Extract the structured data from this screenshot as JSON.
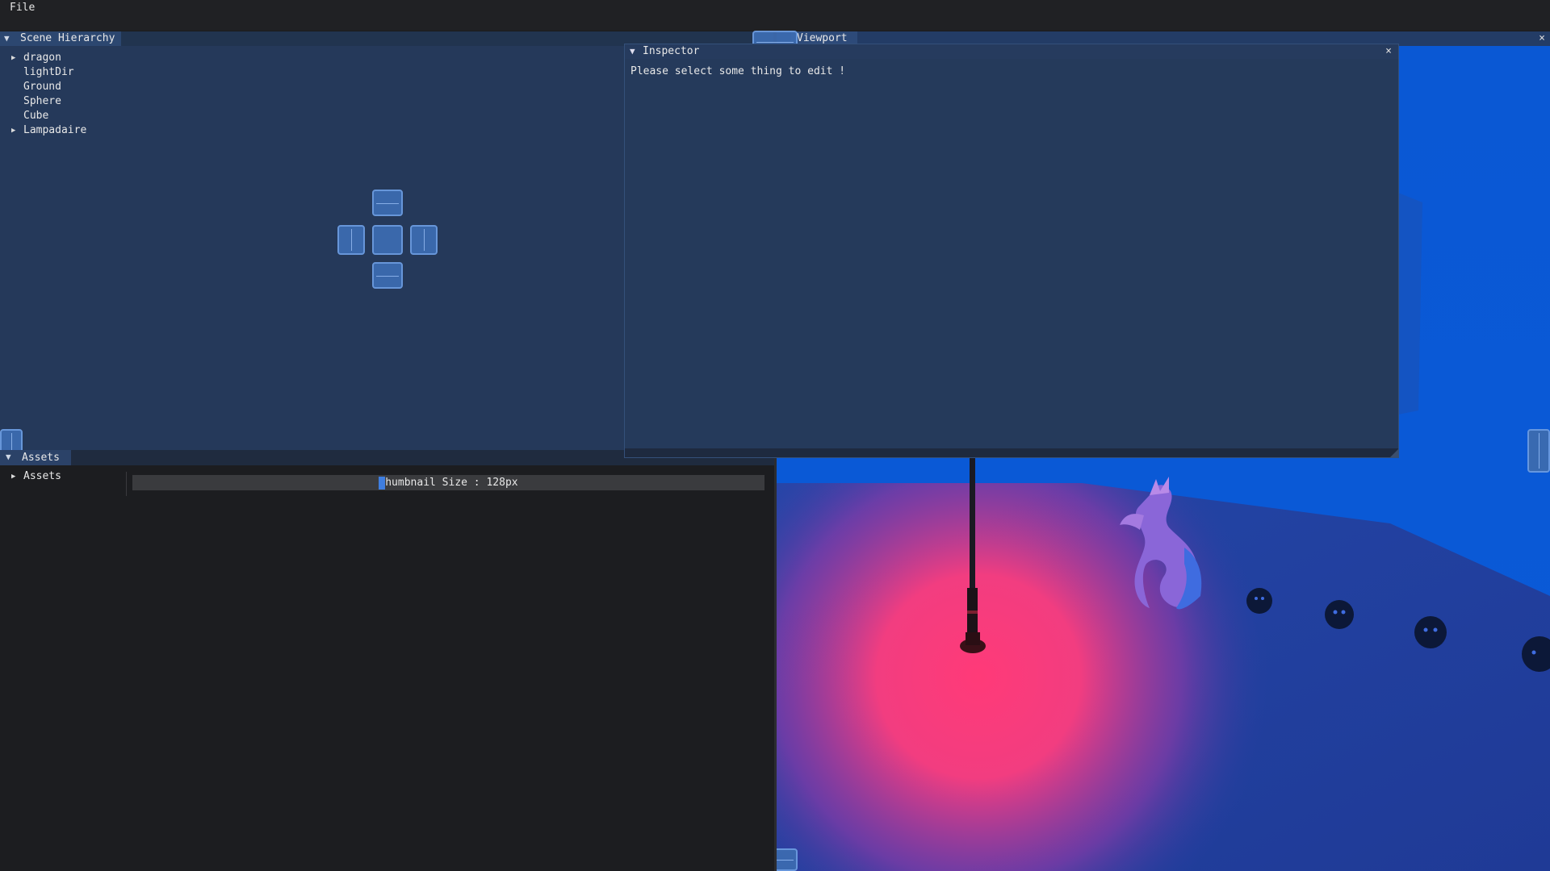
{
  "menubar": {
    "file_label": "File"
  },
  "hierarchy": {
    "tab_label": "Scene Hierarchy",
    "items": [
      {
        "label": "dragon",
        "has_children": true
      },
      {
        "label": "lightDir",
        "has_children": false
      },
      {
        "label": "Ground",
        "has_children": false
      },
      {
        "label": "Sphere",
        "has_children": false
      },
      {
        "label": "Cube",
        "has_children": false
      },
      {
        "label": "Lampadaire",
        "has_children": true
      }
    ]
  },
  "viewport": {
    "tab_label": "Viewport",
    "close_glyph": "×"
  },
  "inspector": {
    "title": "Inspector",
    "close_glyph": "×",
    "message": "Please select some thing to edit !"
  },
  "assets": {
    "tab_label": "Assets",
    "tree_root": "Assets",
    "thumbnail_slider_label": "Thumbnail Size : 128px"
  },
  "icons": {
    "tab_menu": "▼",
    "collapsed_arrow": "▶",
    "window_collapse": "▼"
  },
  "colors": {
    "panel_blue": "#25395a",
    "viewport_floor": "#1f3f9e",
    "viewport_sky": "#0b5bd6",
    "light_spot": "#ff3f7a",
    "dock_guide": "#3c6bb0"
  }
}
